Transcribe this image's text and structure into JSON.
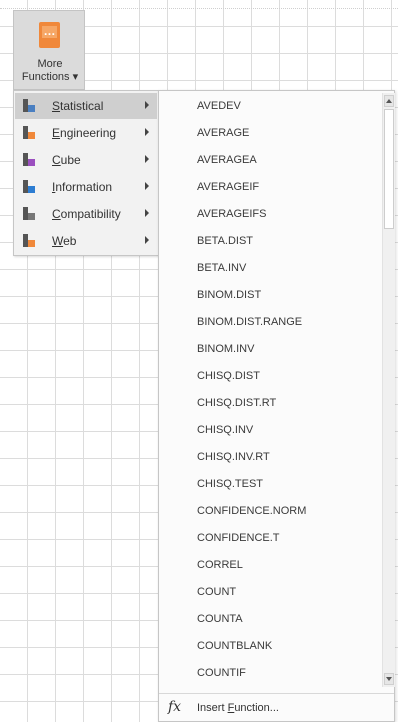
{
  "ribbon": {
    "more_functions": {
      "line1": "More",
      "line2": "Functions ▾",
      "icon": "more-functions-icon"
    }
  },
  "categories": [
    {
      "label_u": "S",
      "label_rest": "tatistical",
      "icon": "statistical-icon",
      "color": "#4a7fc1",
      "active": true
    },
    {
      "label_u": "E",
      "label_rest": "ngineering",
      "icon": "engineering-icon",
      "color": "#f0883a",
      "active": false
    },
    {
      "label_u": "C",
      "label_rest": "ube",
      "icon": "cube-icon",
      "color": "#9b4fbf",
      "active": false
    },
    {
      "label_u": "I",
      "label_rest": "nformation",
      "icon": "information-icon",
      "color": "#2d7dd2",
      "active": false
    },
    {
      "label_u": "C",
      "label_rest": "ompatibility",
      "icon": "compatibility-icon",
      "color": "#777777",
      "active": false
    },
    {
      "label_u": "W",
      "label_rest": "eb",
      "icon": "web-icon",
      "color": "#f0883a",
      "active": false
    }
  ],
  "functions": [
    "AVEDEV",
    "AVERAGE",
    "AVERAGEA",
    "AVERAGEIF",
    "AVERAGEIFS",
    "BETA.DIST",
    "BETA.INV",
    "BINOM.DIST",
    "BINOM.DIST.RANGE",
    "BINOM.INV",
    "CHISQ.DIST",
    "CHISQ.DIST.RT",
    "CHISQ.INV",
    "CHISQ.INV.RT",
    "CHISQ.TEST",
    "CONFIDENCE.NORM",
    "CONFIDENCE.T",
    "CORREL",
    "COUNT",
    "COUNTA",
    "COUNTBLANK",
    "COUNTIF"
  ],
  "insert_function": {
    "icon_text": "fx",
    "label_prefix": "Insert ",
    "label_u": "F",
    "label_rest": "unction..."
  }
}
